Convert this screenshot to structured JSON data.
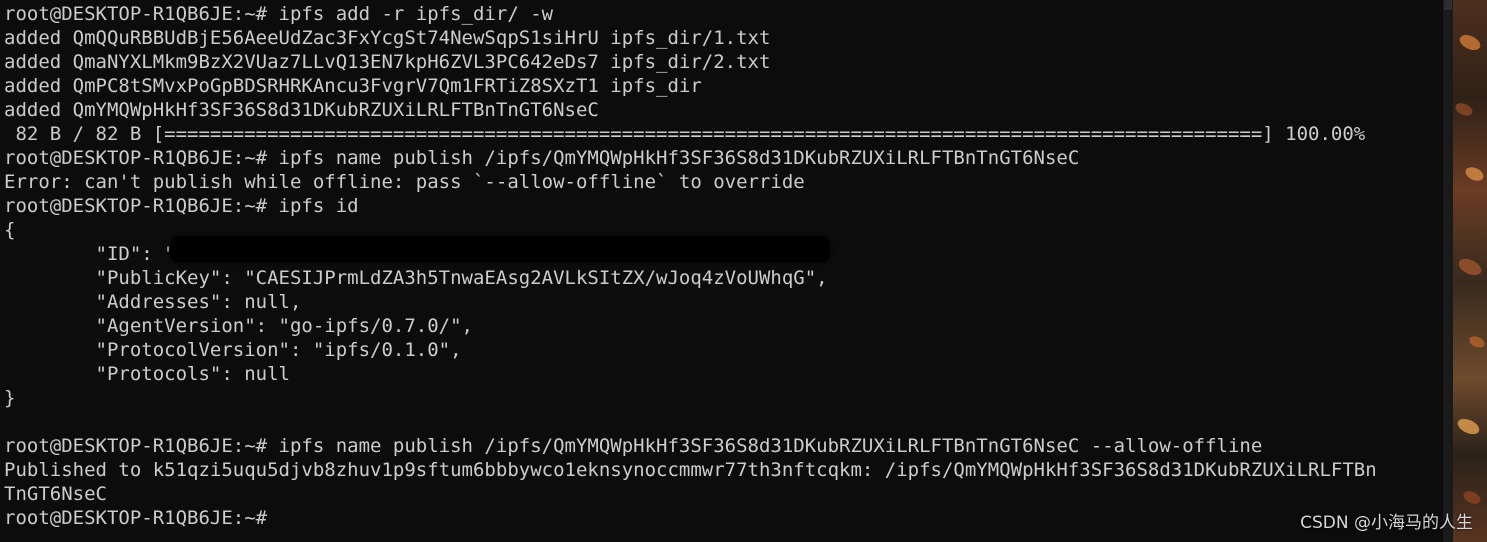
{
  "terminal": {
    "lines": [
      "root@DESKTOP-R1QB6JE:~# ipfs add -r ipfs_dir/ -w",
      "added QmQQuRBBUdBjE56AeeUdZac3FxYcgSt74NewSqpS1siHrU ipfs_dir/1.txt",
      "added QmaNYXLMkm9BzX2VUaz7LLvQ13EN7kpH6ZVL3PC642eDs7 ipfs_dir/2.txt",
      "added QmPC8tSMvxPoGpBDSRHRKAncu3FvgrV7Qm1FRTiZ8SXzT1 ipfs_dir",
      "added QmYMQWpHkHf3SF36S8d31DKubRZUXiLRLFTBnTnGT6NseC",
      " 82 B / 82 B [================================================================================================] 100.00%",
      "root@DESKTOP-R1QB6JE:~# ipfs name publish /ipfs/QmYMQWpHkHf3SF36S8d31DKubRZUXiLRLFTBnTnGT6NseC",
      "Error: can't publish while offline: pass `--allow-offline` to override",
      "root@DESKTOP-R1QB6JE:~# ipfs id",
      "{",
      "        \"ID\": \"",
      "        \"PublicKey\": \"CAESIJPrmLdZA3h5TnwaEAsg2AVLkSItZX/wJoq4zVoUWhqG\",",
      "        \"Addresses\": null,",
      "        \"AgentVersion\": \"go-ipfs/0.7.0/\",",
      "        \"ProtocolVersion\": \"ipfs/0.1.0\",",
      "        \"Protocols\": null",
      "}",
      "",
      "root@DESKTOP-R1QB6JE:~# ipfs name publish /ipfs/QmYMQWpHkHf3SF36S8d31DKubRZUXiLRLFTBnTnGT6NseC --allow-offline",
      "Published to k51qzi5uqu5djvb8zhuv1p9sftum6bbbywco1eknsynoccmmwr77th3nftcqkm: /ipfs/QmYMQWpHkHf3SF36S8d31DKubRZUXiLRLFTBn",
      "TnGT6NseC",
      "root@DESKTOP-R1QB6JE:~#"
    ]
  },
  "watermark": {
    "text": "CSDN @小海马的人生"
  },
  "colors": {
    "terminal_background": "#0c0c0c",
    "terminal_text": "#cccccc",
    "scrollbar": "#1a1a1a"
  },
  "icons": {
    "redaction": "blurred-id-redaction",
    "desktop_wallpaper": "autumn-leaves-wallpaper"
  }
}
